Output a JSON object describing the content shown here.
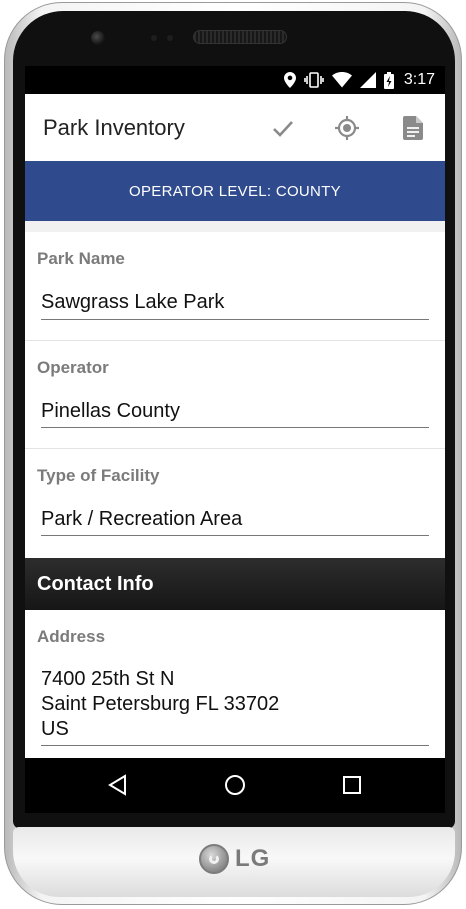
{
  "device": {
    "brand": "LG"
  },
  "status_bar": {
    "time": "3:17",
    "icons": [
      "location-icon",
      "vibrate-icon",
      "wifi-icon",
      "signal-icon",
      "battery-charging-icon"
    ]
  },
  "app_bar": {
    "title": "Park Inventory",
    "actions": [
      "check-icon",
      "gps-target-icon",
      "document-icon"
    ]
  },
  "banner": {
    "text": "OPERATOR LEVEL: COUNTY",
    "color": "#2f4b8e"
  },
  "form": {
    "park_name": {
      "label": "Park Name",
      "value": "Sawgrass Lake Park"
    },
    "operator": {
      "label": "Operator",
      "value": "Pinellas County"
    },
    "facility_type": {
      "label": "Type of Facility",
      "value": "Park / Recreation Area"
    },
    "contact_section": {
      "title": "Contact Info"
    },
    "address": {
      "label": "Address",
      "value": "7400 25th St N\nSaint Petersburg FL 33702\nUS"
    }
  },
  "nav_bar": {
    "buttons": [
      "back-icon",
      "home-icon",
      "recents-icon"
    ]
  }
}
